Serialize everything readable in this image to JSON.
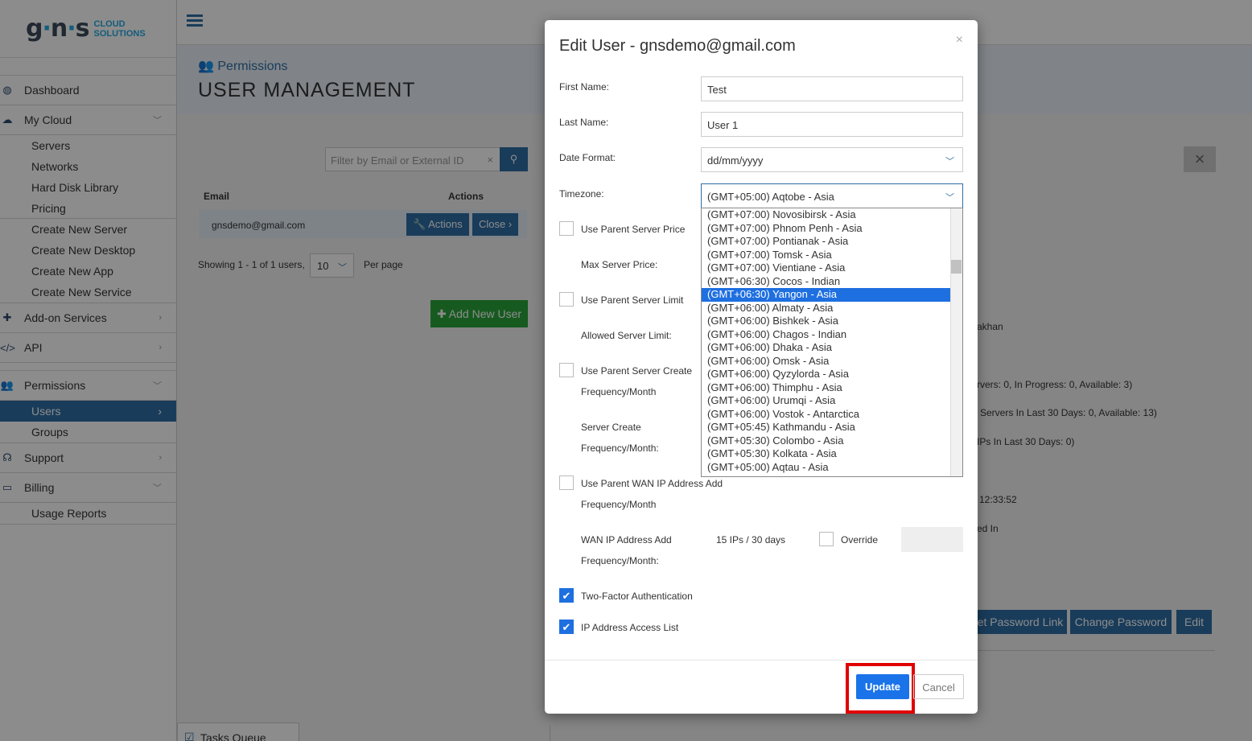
{
  "sidebar": {
    "logo_mark_g": "g",
    "logo_mark_n": "n",
    "logo_mark_s": "s",
    "logo_text_1": "CLOUD",
    "logo_text_2": "SOLUTIONS",
    "items": [
      {
        "label": "Dashboard",
        "icon": "dashboard-icon"
      },
      {
        "label": "My Cloud",
        "icon": "cloud-icon"
      },
      {
        "label": "Add-on Services",
        "icon": "puzzle-icon"
      },
      {
        "label": "API",
        "icon": "code-icon"
      },
      {
        "label": "Permissions",
        "icon": "users-icon"
      },
      {
        "label": "Support",
        "icon": "headset-icon"
      },
      {
        "label": "Billing",
        "icon": "credit-card-icon"
      }
    ],
    "my_cloud_sub": [
      "Servers",
      "Networks",
      "Hard Disk Library",
      "Pricing",
      "Create New Server",
      "Create New Desktop",
      "Create New App",
      "Create New Service"
    ],
    "permissions_sub": [
      "Users",
      "Groups"
    ],
    "billing_sub": [
      "Usage Reports"
    ]
  },
  "header": {
    "breadcrumb": "Permissions",
    "title": "USER MANAGEMENT"
  },
  "list": {
    "filter_placeholder": "Filter by Email or External ID",
    "col_email": "Email",
    "col_actions": "Actions",
    "row_email": "gnsdemo@gmail.com",
    "actions_btn": "Actions",
    "close_btn": "Close",
    "showing": "Showing 1 - 1 of 1 users,",
    "per_page_value": "10",
    "per_page_label": "Per page",
    "add_user": "Add New User"
  },
  "right_panel": {
    "t1": "akhan",
    "t2": "rvers: 0, In Progress: 0, Available: 3)",
    "t3": "Servers In Last 30 Days: 0, Available: 13)",
    "t4": "IPs In Last 30 Days: 0)",
    "t5": "12:33:52",
    "t6": "ed In",
    "reset_btn": "et Password Link",
    "change_pw_btn": "Change Password",
    "edit_btn": "Edit"
  },
  "tasks_queue": "Tasks Queue",
  "modal": {
    "title": "Edit User - gnsdemo@gmail.com",
    "close": "×",
    "first_name_label": "First Name:",
    "first_name_value": "Test",
    "last_name_label": "Last Name:",
    "last_name_value": "User 1",
    "date_format_label": "Date Format:",
    "date_format_value": "dd/mm/yyyy",
    "timezone_label": "Timezone:",
    "timezone_value": "(GMT+05:00) Aqtobe - Asia",
    "use_parent_server_price": "Use Parent Server Price",
    "max_server_price": "Max Server Price:",
    "use_parent_server_limit": "Use Parent Server Limit",
    "allowed_server_limit": "Allowed Server Limit:",
    "use_parent_server_create": "Use Parent Server Create",
    "frequency_month": "Frequency/Month",
    "server_create": "Server Create",
    "frequency_month_colon": "Frequency/Month:",
    "use_parent_wan": "Use Parent WAN IP Address Add",
    "wan_ip_add": "WAN IP Address Add",
    "wan_value": "15 IPs / 30 days",
    "override": "Override",
    "two_factor": "Two-Factor Authentication",
    "ip_access": "IP Address Access List",
    "checkmark": "✔",
    "update_btn": "Update",
    "cancel_btn": "Cancel"
  },
  "timezone_options": [
    "(GMT+07:00) Novosibirsk - Asia",
    "(GMT+07:00) Phnom Penh - Asia",
    "(GMT+07:00) Pontianak - Asia",
    "(GMT+07:00) Tomsk - Asia",
    "(GMT+07:00) Vientiane - Asia",
    "(GMT+06:30) Cocos - Indian",
    "(GMT+06:30) Yangon - Asia",
    "(GMT+06:00) Almaty - Asia",
    "(GMT+06:00) Bishkek - Asia",
    "(GMT+06:00) Chagos - Indian",
    "(GMT+06:00) Dhaka - Asia",
    "(GMT+06:00) Omsk - Asia",
    "(GMT+06:00) Qyzylorda - Asia",
    "(GMT+06:00) Thimphu - Asia",
    "(GMT+06:00) Urumqi - Asia",
    "(GMT+06:00) Vostok - Antarctica",
    "(GMT+05:45) Kathmandu - Asia",
    "(GMT+05:30) Colombo - Asia",
    "(GMT+05:30) Kolkata - Asia",
    "(GMT+05:00) Aqtau - Asia"
  ],
  "selected_timezone_index": 6,
  "colors": {
    "primary": "#2e6da4",
    "success": "#2aa53b",
    "highlight": "#e00000"
  }
}
